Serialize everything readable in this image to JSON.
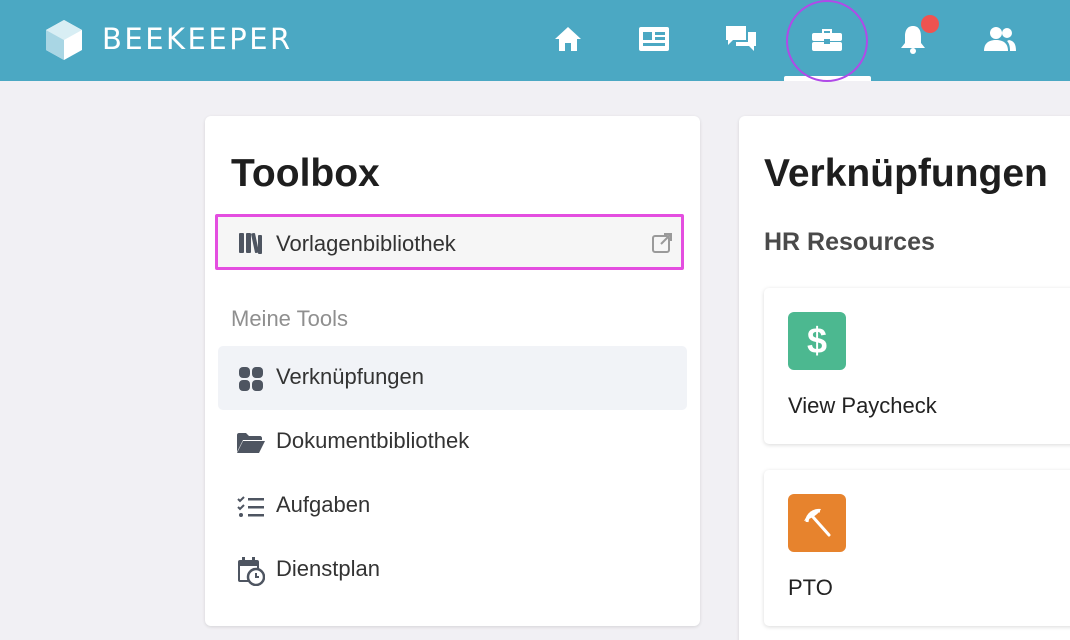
{
  "app": {
    "brand": "BEEKEEPER"
  },
  "nav": {
    "items": [
      {
        "icon": "home-icon"
      },
      {
        "icon": "news-icon"
      },
      {
        "icon": "chat-icon"
      },
      {
        "icon": "toolbox-icon",
        "active": true
      },
      {
        "icon": "bell-icon",
        "has_notification": true
      },
      {
        "icon": "people-icon"
      }
    ]
  },
  "toolbox": {
    "title": "Toolbox",
    "template_library": {
      "label": "Vorlagenbibliothek",
      "icon": "books-icon",
      "action_icon": "external-link-icon"
    },
    "section_label": "Meine Tools",
    "items": [
      {
        "label": "Verknüpfungen",
        "icon": "grid-icon",
        "active": true
      },
      {
        "label": "Dokumentbibliothek",
        "icon": "folder-open-icon"
      },
      {
        "label": "Aufgaben",
        "icon": "checklist-icon"
      },
      {
        "label": "Dienstplan",
        "icon": "calendar-clock-icon"
      }
    ]
  },
  "shortcuts": {
    "title": "Verknüpfungen",
    "section": "HR Resources",
    "tiles": [
      {
        "label": "View Paycheck",
        "icon": "dollar-icon",
        "color": "#4cb890"
      },
      {
        "label": "PTO",
        "icon": "umbrella-icon",
        "color": "#e7832d"
      }
    ]
  },
  "colors": {
    "header": "#4ba8c3",
    "highlight_outline": "#e44ee0",
    "notification": "#ef5350"
  }
}
